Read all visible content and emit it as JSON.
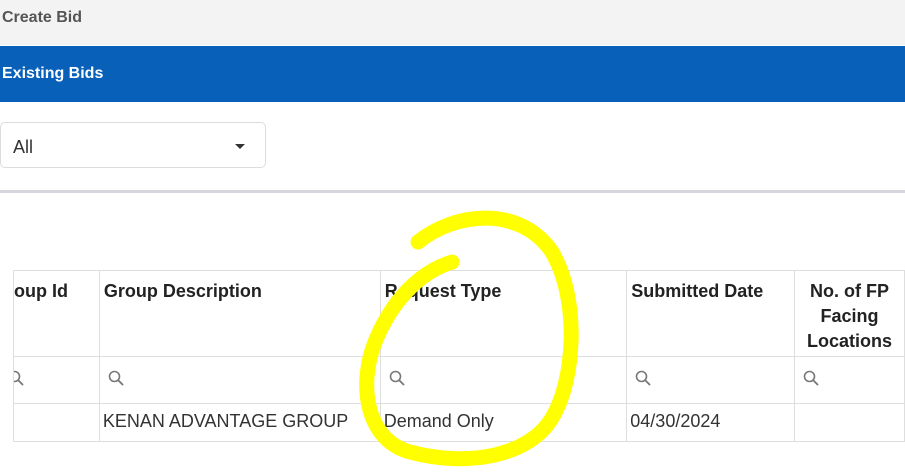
{
  "tabs": {
    "create": "Create Bid",
    "existing": "Existing Bids"
  },
  "filter": {
    "selected": "All"
  },
  "table": {
    "columns": [
      "oup Id",
      "Group Description",
      "Request Type",
      "Submitted Date",
      "No. of FP Facing Locations"
    ],
    "rows": [
      [
        "",
        "KENAN ADVANTAGE GROUP",
        "Demand Only",
        "04/30/2024",
        ""
      ]
    ]
  },
  "annotation": {
    "color": "#ffff00"
  }
}
